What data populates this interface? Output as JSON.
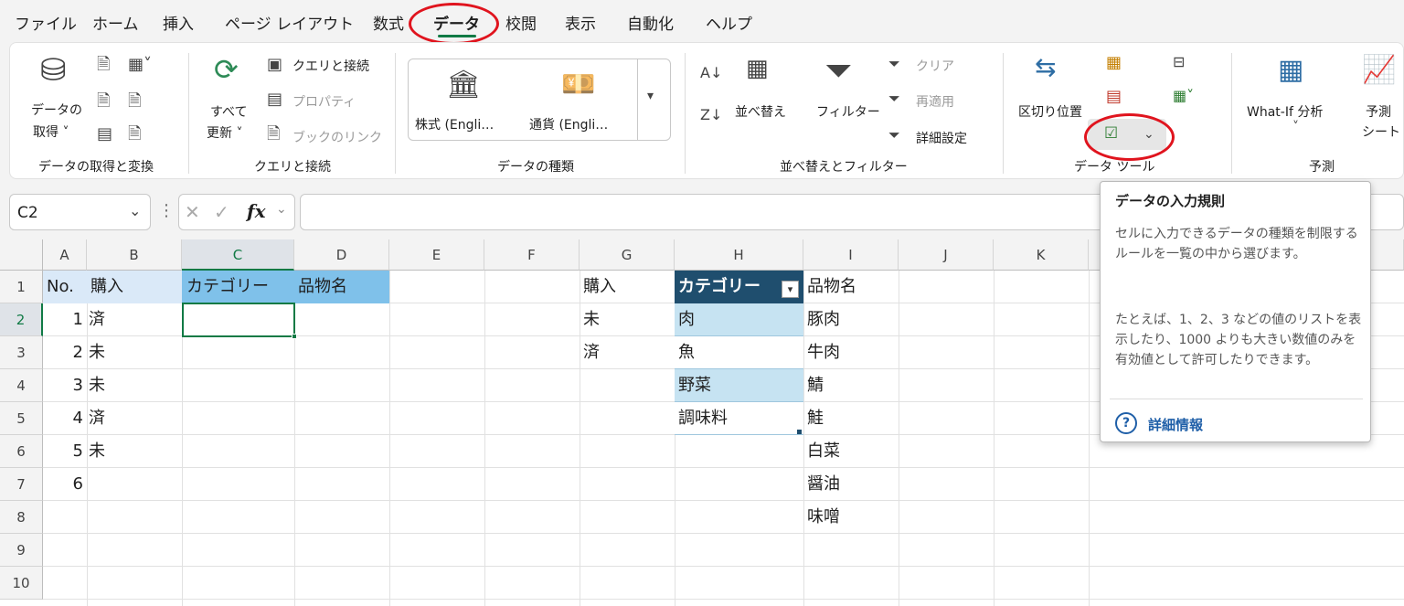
{
  "menu": {
    "tabs": [
      "ファイル",
      "ホーム",
      "挿入",
      "ページ レイアウト",
      "数式",
      "データ",
      "校閲",
      "表示",
      "自動化",
      "ヘルプ"
    ],
    "active_tab": "データ"
  },
  "ribbon": {
    "get_data": {
      "line1": "データの",
      "line2": "取得 ˅",
      "group": "データの取得と変換"
    },
    "queries": {
      "refresh_line1": "すべて",
      "refresh_line2": "更新 ˅",
      "queries_connections": "クエリと接続",
      "properties": "プロパティ",
      "book_links": "ブックのリンク",
      "group": "クエリと接続"
    },
    "data_types": {
      "stock": "株式 (Engli…",
      "currency": "通貨 (Engli…",
      "group": "データの種類"
    },
    "sort_filter": {
      "sort": "並べ替え",
      "filter": "フィルター",
      "clear": "クリア",
      "reapply": "再適用",
      "advanced": "詳細設定",
      "group": "並べ替えとフィルター"
    },
    "data_tools": {
      "text_to_columns": "区切り位置",
      "group": "データ ツール"
    },
    "forecast": {
      "what_if": "What-If 分析",
      "forecast_sheet_line1": "予測",
      "forecast_sheet_line2": "シート",
      "group": "予測"
    }
  },
  "formula_bar": {
    "name_box": "C2",
    "fx": "fx",
    "value": ""
  },
  "columns": [
    "A",
    "B",
    "C",
    "D",
    "E",
    "F",
    "G",
    "H",
    "I",
    "J",
    "K"
  ],
  "selected_column": "C",
  "rows": [
    "1",
    "2",
    "3",
    "4",
    "5",
    "6",
    "7",
    "8",
    "9",
    "10"
  ],
  "selected_row": "2",
  "sheet": {
    "headers": {
      "a": "No.",
      "b": "購入",
      "c": "カテゴリー",
      "d": "品物名"
    },
    "numbers": [
      "1",
      "2",
      "3",
      "4",
      "5",
      "6"
    ],
    "purchase": [
      "済",
      "未",
      "未",
      "済",
      "未"
    ],
    "lookup_purchase_header": "購入",
    "lookup_purchase": [
      "未",
      "済"
    ],
    "category_header": "カテゴリー",
    "categories": [
      "肉",
      "魚",
      "野菜",
      "調味料"
    ],
    "item_header": "品物名",
    "items": [
      "豚肉",
      "牛肉",
      "鯖",
      "鮭",
      "白菜",
      "醤油",
      "味噌"
    ]
  },
  "tooltip": {
    "title": "データの入力規則",
    "para1": "セルに入力できるデータの種類を制限するルールを一覧の中から選びます。",
    "para2": "たとえば、1、2、3 などの値のリストを表示したり、1000 よりも大きい数値のみを有効値として許可したりできます。",
    "link": "詳細情報"
  },
  "colors": {
    "accent": "#117a45",
    "table_header": "#1f4e6e",
    "table_band": "#c6e3f2",
    "highlight_red": "#e0141e",
    "link": "#1f5fa8"
  }
}
